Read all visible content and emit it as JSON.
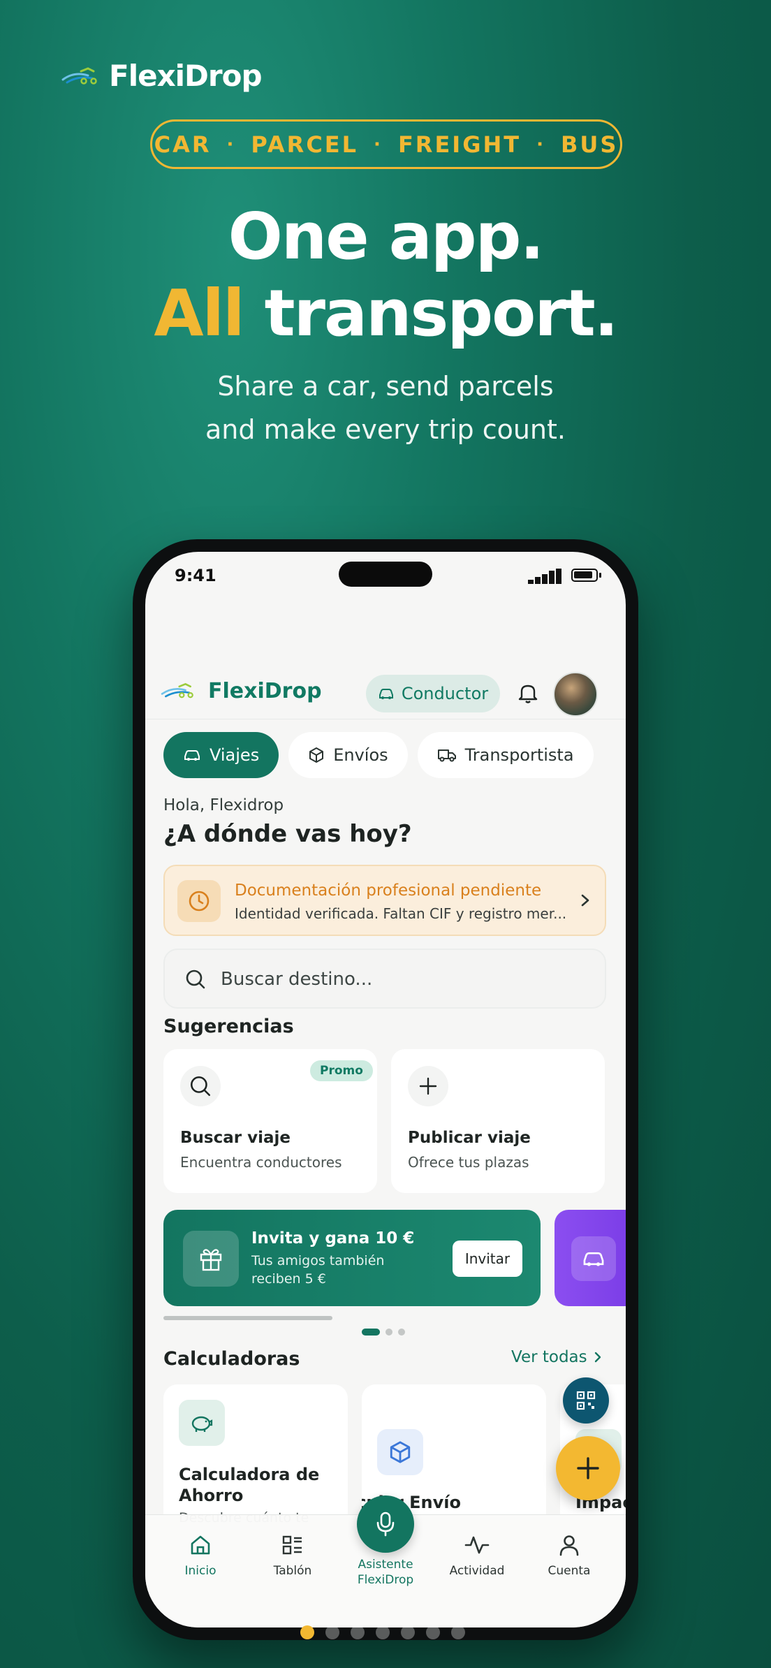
{
  "brand": {
    "name": "FlexiDrop"
  },
  "modes": [
    "CAR",
    "PARCEL",
    "FREIGHT",
    "BUS"
  ],
  "hero": {
    "line1": "One app.",
    "line2_accent": "All",
    "line2_rest": " transport."
  },
  "subtitle": {
    "line1": "Share a car, send parcels",
    "line2": "and make every trip count."
  },
  "status_bar": {
    "time": "9:41"
  },
  "app": {
    "name": "FlexiDrop",
    "role": "Conductor",
    "tabs": [
      {
        "label": "Viajes",
        "icon": "car-icon",
        "active": true
      },
      {
        "label": "Envíos",
        "icon": "package-icon",
        "active": false
      },
      {
        "label": "Transportista",
        "icon": "truck-icon",
        "active": false
      }
    ],
    "greeting": "Hola, Flexidrop",
    "question": "¿A dónde vas hoy?",
    "alert": {
      "title": "Documentación profesional pendiente",
      "text": "Identidad verificada. Faltan CIF y registro mer..."
    },
    "search": {
      "placeholder": "Buscar destino..."
    },
    "suggestions": {
      "title": "Sugerencias",
      "items": [
        {
          "title": "Buscar viaje",
          "text": "Encuentra conductores",
          "badge": "Promo",
          "icon": "search-icon"
        },
        {
          "title": "Publicar viaje",
          "text": "Ofrece tus plazas",
          "icon": "plus-icon"
        }
      ]
    },
    "banner": {
      "title": "Invita y gana 10 €",
      "text": "Tus amigos también reciben 5 €",
      "button": "Invitar"
    },
    "carousel_position": {
      "current": 1,
      "total": 3
    },
    "calculators": {
      "title": "Calculadoras",
      "see_all": "Ver todas",
      "items": [
        {
          "title": "Calculadora de Ahorro",
          "text": "Descubre cuánto te",
          "icon": "piggy-bank-icon"
        },
        {
          "title": "Calcular Envío",
          "title_visible": "lcular Envío",
          "icon": "cube-icon"
        },
        {
          "title": "Impac",
          "icon": "leaf-icon"
        }
      ]
    },
    "nav": {
      "items": [
        {
          "label": "Inicio",
          "active": true
        },
        {
          "label": "Tablón",
          "active": false
        },
        {
          "label": "Asistente FlexiDrop",
          "line1": "Asistente",
          "line2": "FlexiDrop",
          "active": false
        },
        {
          "label": "Actividad",
          "active": false
        },
        {
          "label": "Cuenta",
          "active": false
        }
      ]
    }
  },
  "page_indicator": {
    "current": 1,
    "total": 7
  },
  "colors": {
    "background": "#0d5e4b",
    "brand_green": "#137560",
    "accent_yellow": "#f1b733",
    "alert_orange": "#d9801d",
    "promo_purple": "#8b4ef0"
  }
}
